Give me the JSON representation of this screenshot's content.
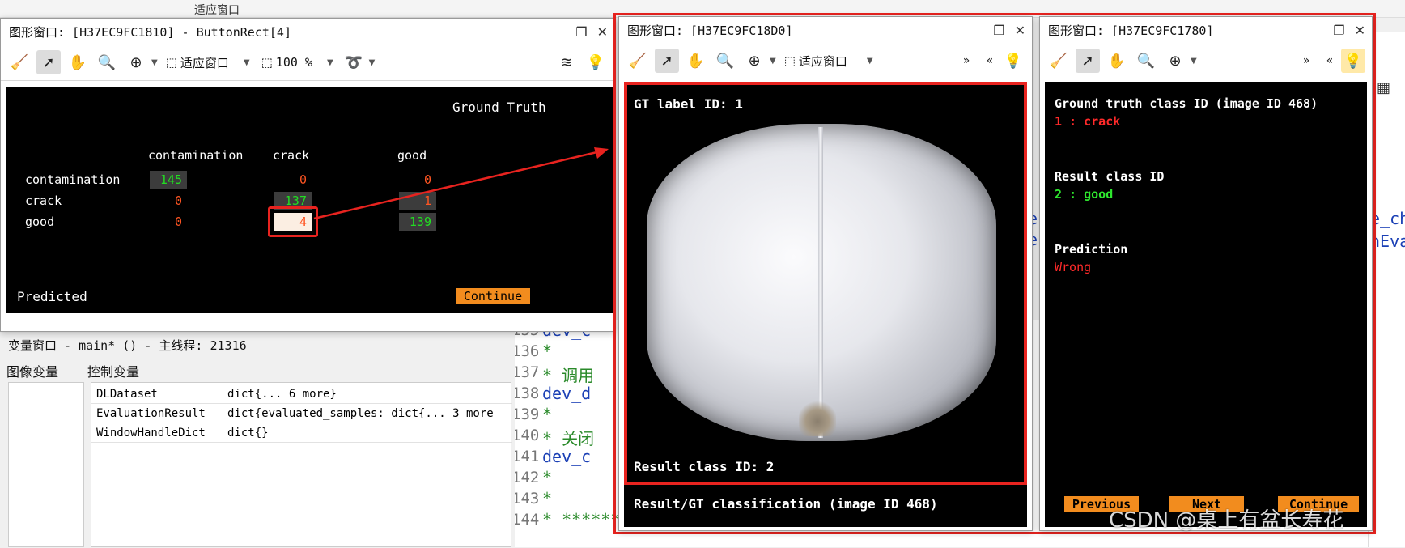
{
  "background": {
    "top_toolbar_fragment": "适应窗口",
    "var_window": {
      "title": "变量窗口 - main* () - 主线程: 21316",
      "tab_image_vars": "图像变量",
      "tab_control_vars": "控制变量",
      "rows": [
        {
          "name": "DLDataset",
          "value": "dict{... 6 more}"
        },
        {
          "name": "EvaluationResult",
          "value": "dict{evaluated_samples: dict{... 3 more"
        },
        {
          "name": "WindowHandleDict",
          "value": "dict{}"
        }
      ]
    },
    "code_lines": [
      {
        "num": "135",
        "text": "dev_c",
        "color": "#1a3fb5"
      },
      {
        "num": "136",
        "text": "*",
        "color": "#2a8a2a"
      },
      {
        "num": "137",
        "text": "* 调用",
        "color": "#2a8a2a"
      },
      {
        "num": "138",
        "text": "dev_d",
        "color": "#1a3fb5"
      },
      {
        "num": "139",
        "text": "*",
        "color": "#2a8a2a"
      },
      {
        "num": "140",
        "text": "* 关闭",
        "color": "#2a8a2a"
      },
      {
        "num": "141",
        "text": "dev_c",
        "color": "#1a3fb5"
      },
      {
        "num": "142",
        "text": "*",
        "color": "#2a8a2a"
      },
      {
        "num": "143",
        "text": "*",
        "color": "#2a8a2a"
      },
      {
        "num": "144",
        "text": "* *****************************",
        "color": "#2a8a2a"
      }
    ],
    "right_code_fragments": {
      "frag1": "e_ch",
      "frag2": "nEva",
      "frag3": "e",
      "frag4": "e"
    },
    "watermark": "CSDN @桌上有盆长寿花"
  },
  "win1": {
    "title": "图形窗口: [H37EC9FC1810] - ButtonRect[4]",
    "fit_label": "适应窗口",
    "zoom_label": "100 %",
    "ground_truth_label": "Ground Truth",
    "predicted_label": "Predicted",
    "continue_label": "Continue",
    "col_headers": [
      "contamination",
      "crack",
      "good"
    ],
    "row_headers": [
      "contamination",
      "crack",
      "good"
    ],
    "matrix": [
      [
        "145",
        "0",
        "0"
      ],
      [
        "0",
        "137",
        "1"
      ],
      [
        "0",
        "4",
        "139"
      ]
    ],
    "colors": {
      "correct": "#22dd22",
      "wrong": "#ff5522",
      "cell_bg": "#3c3c3c",
      "highlight": "#e8231f",
      "selected_cell_bg": "#fbeee2"
    }
  },
  "win2": {
    "title": "图形窗口: [H37EC9FC18D0]",
    "fit_label": "适应窗口",
    "gt_label": "GT label ID: 1",
    "result_label": "Result class ID: 2",
    "footer": "Result/GT classification (image ID 468)"
  },
  "win3": {
    "title": "图形窗口: [H37EC9FC1780]",
    "gt_heading": "Ground truth class ID (image ID 468)",
    "gt_value": "1 : crack",
    "result_heading": "Result class ID",
    "result_value": "2 : good",
    "prediction_heading": "Prediction",
    "prediction_value": "Wrong",
    "btn_previous": "Previous",
    "btn_next": "Next",
    "btn_continue": "Continue"
  }
}
